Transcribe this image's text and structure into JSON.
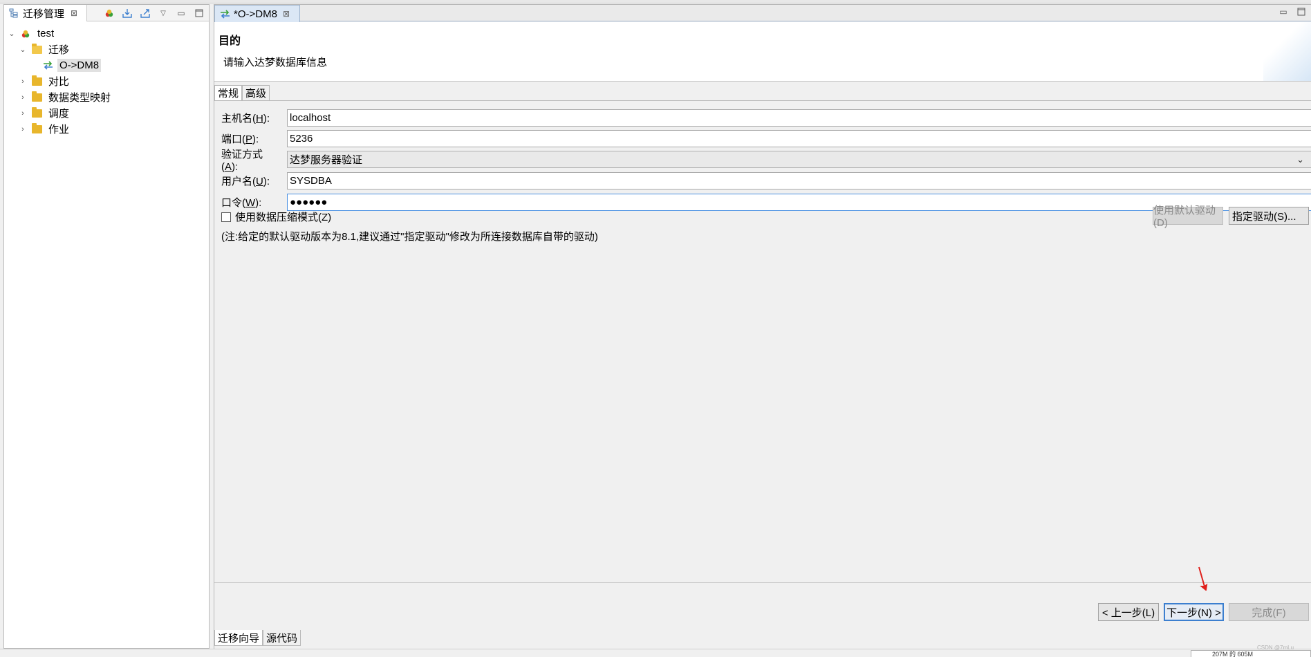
{
  "left_panel": {
    "tab_label": "迁移管理",
    "tree": {
      "root": "test",
      "migration_folder": "迁移",
      "migration_item": "O->DM8",
      "compare_folder": "对比",
      "datatype_folder": "数据类型映射",
      "schedule_folder": "调度",
      "job_folder": "作业"
    }
  },
  "editor": {
    "tab_label": "*O->DM8",
    "title": "目的",
    "description": "请输入达梦数据库信息",
    "tabs": {
      "general": "常规",
      "advanced": "高级"
    },
    "fields": {
      "host_label_pre": "主机名(",
      "host_label_key": "H",
      "host_label_post": "):",
      "host_value": "localhost",
      "port_label_pre": "端口(",
      "port_label_key": "P",
      "port_label_post": "):",
      "port_value": "5236",
      "auth_label_pre": "验证方式(",
      "auth_label_key": "A",
      "auth_label_post": "):",
      "auth_value": "达梦服务器验证",
      "user_label_pre": "用户名(",
      "user_label_key": "U",
      "user_label_post": "):",
      "user_value": "SYSDBA",
      "password_label_pre": "口令(",
      "password_label_key": "W",
      "password_label_post": "):",
      "password_value": "●●●●●●"
    },
    "compress_label": "使用数据压缩模式(Z)",
    "default_driver_btn": "使用默认驱动(D)",
    "specify_driver_btn": "指定驱动(S)...",
    "note": "(注:给定的默认驱动版本为8.1,建议通过\"指定驱动\"修改为所连接数据库自带的驱动)",
    "prev_btn": "< 上一步(L)",
    "next_btn": "下一步(N) >",
    "finish_btn": "完成(F)",
    "bottom_tabs": {
      "wizard": "迁移向导",
      "source": "源代码"
    }
  },
  "status": {
    "memory": "207M 的 605M"
  },
  "watermark": "CSDN @7mLu"
}
